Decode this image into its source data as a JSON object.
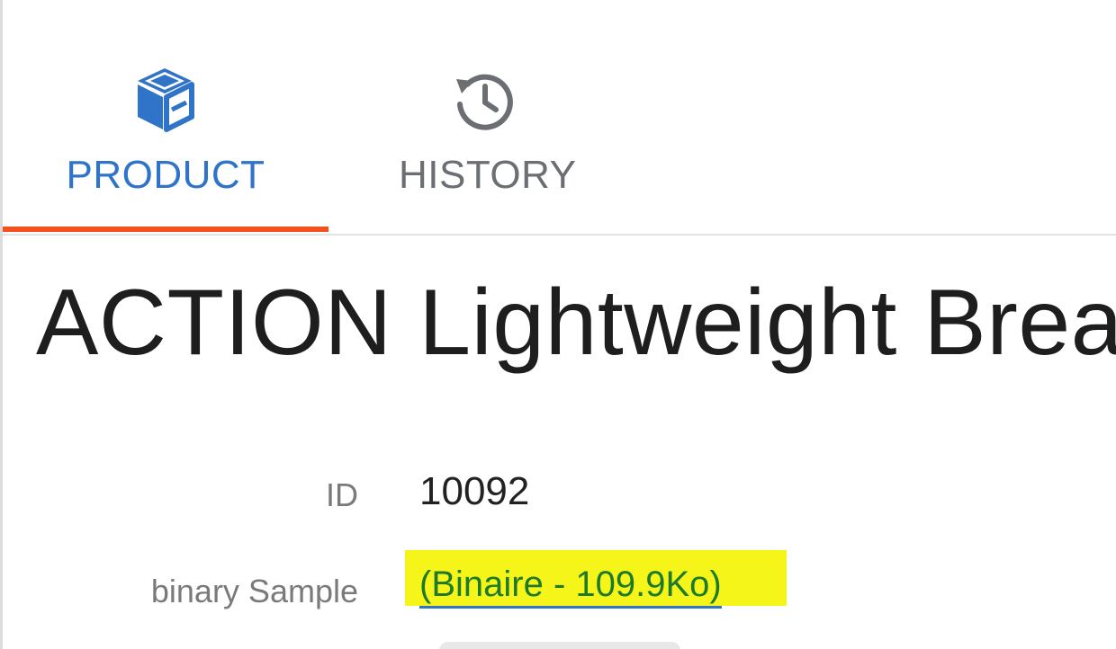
{
  "tabs": [
    {
      "label": "PRODUCT",
      "icon": "cube-icon",
      "active": true
    },
    {
      "label": "HISTORY",
      "icon": "history-icon",
      "active": false
    }
  ],
  "product": {
    "title": "ACTION Lightweight Brea"
  },
  "fields": {
    "id_label": "ID",
    "id_value": "10092",
    "binary_label": "binary Sample",
    "binary_value": "(Binaire - 109.9Ko)"
  },
  "colors": {
    "active_tab": "#2f74c9",
    "inactive_tab": "#6b6f74",
    "indicator": "#f4511e",
    "highlight": "#f5f51a",
    "link": "#1d7a2a"
  }
}
